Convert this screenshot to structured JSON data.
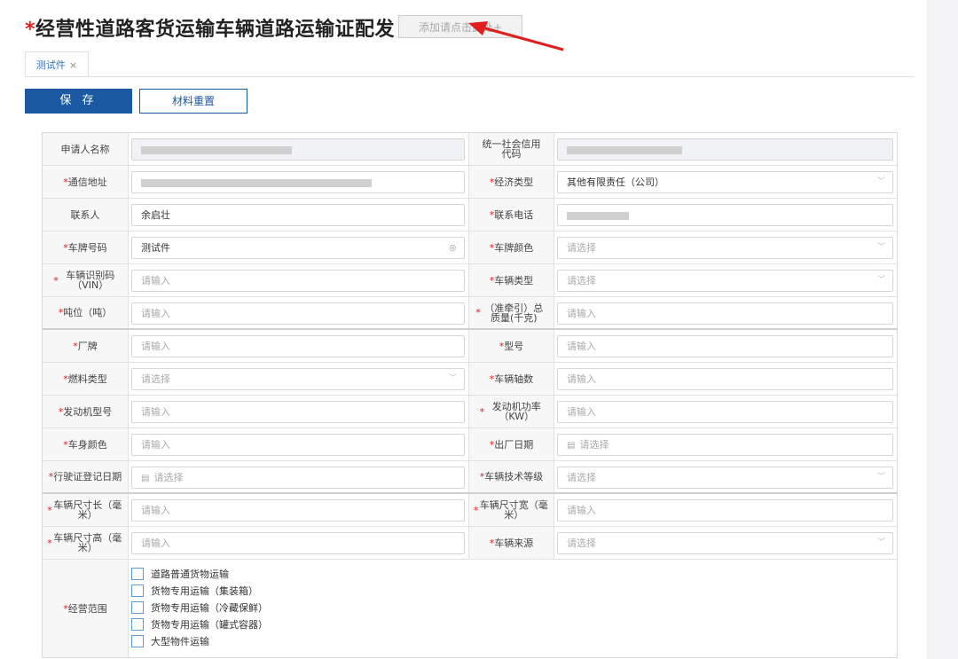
{
  "header": {
    "title_star": "*",
    "title": "经营性道路客货运输车辆道路运输证配发",
    "add_button": "添加请点击此处+"
  },
  "tabs": [
    {
      "label": "测试件",
      "close": "×"
    }
  ],
  "toolbar": {
    "save": "保 存",
    "reset": "材料重置"
  },
  "icons": {
    "dropdown": "chevron-down-icon",
    "clear": "clear-circle-icon",
    "calendar": "calendar-icon",
    "tab_close": "close-icon"
  },
  "accent_color": "#1b5aa3",
  "required_color": "#e02020",
  "form": {
    "applicant_name_label": "申请人名称",
    "credit_code_label": "统一社会信用代码",
    "address_label": "通信地址",
    "economy_type_label": "经济类型",
    "economy_type_value": "其他有限责任（公司）",
    "contact_label": "联系人",
    "contact_value": "余启壮",
    "phone_label": "联系电话",
    "plate_no_label": "车牌号码",
    "plate_no_value": "测试件",
    "plate_color_label": "车牌颜色",
    "vin_label": "车辆识别码（VIN）",
    "vehicle_type_label": "车辆类型",
    "tonnage_label": "吨位（吨）",
    "total_mass_label": "（准牵引）总质量(千克)",
    "brand_label": "厂牌",
    "model_label": "型号",
    "fuel_label": "燃料类型",
    "axles_label": "车辆轴数",
    "engine_model_label": "发动机型号",
    "engine_power_label": "发动机功率（KW）",
    "body_color_label": "车身颜色",
    "factory_date_label": "出厂日期",
    "license_reg_date_label": "行驶证登记日期",
    "tech_level_label": "车辆技术等级",
    "length_label": "车辆尺寸长（毫米）",
    "width_label": "车辆尺寸宽（毫米）",
    "height_label": "车辆尺寸高（毫米）",
    "source_label": "车辆来源",
    "scope_label": "经营范围",
    "ph_input": "请输入",
    "ph_select": "请选择",
    "scope_options": [
      "道路普通货物运输",
      "货物专用运输（集装箱）",
      "货物专用运输（冷藏保鲜）",
      "货物专用运输（罐式容器）",
      "大型物件运输"
    ]
  }
}
